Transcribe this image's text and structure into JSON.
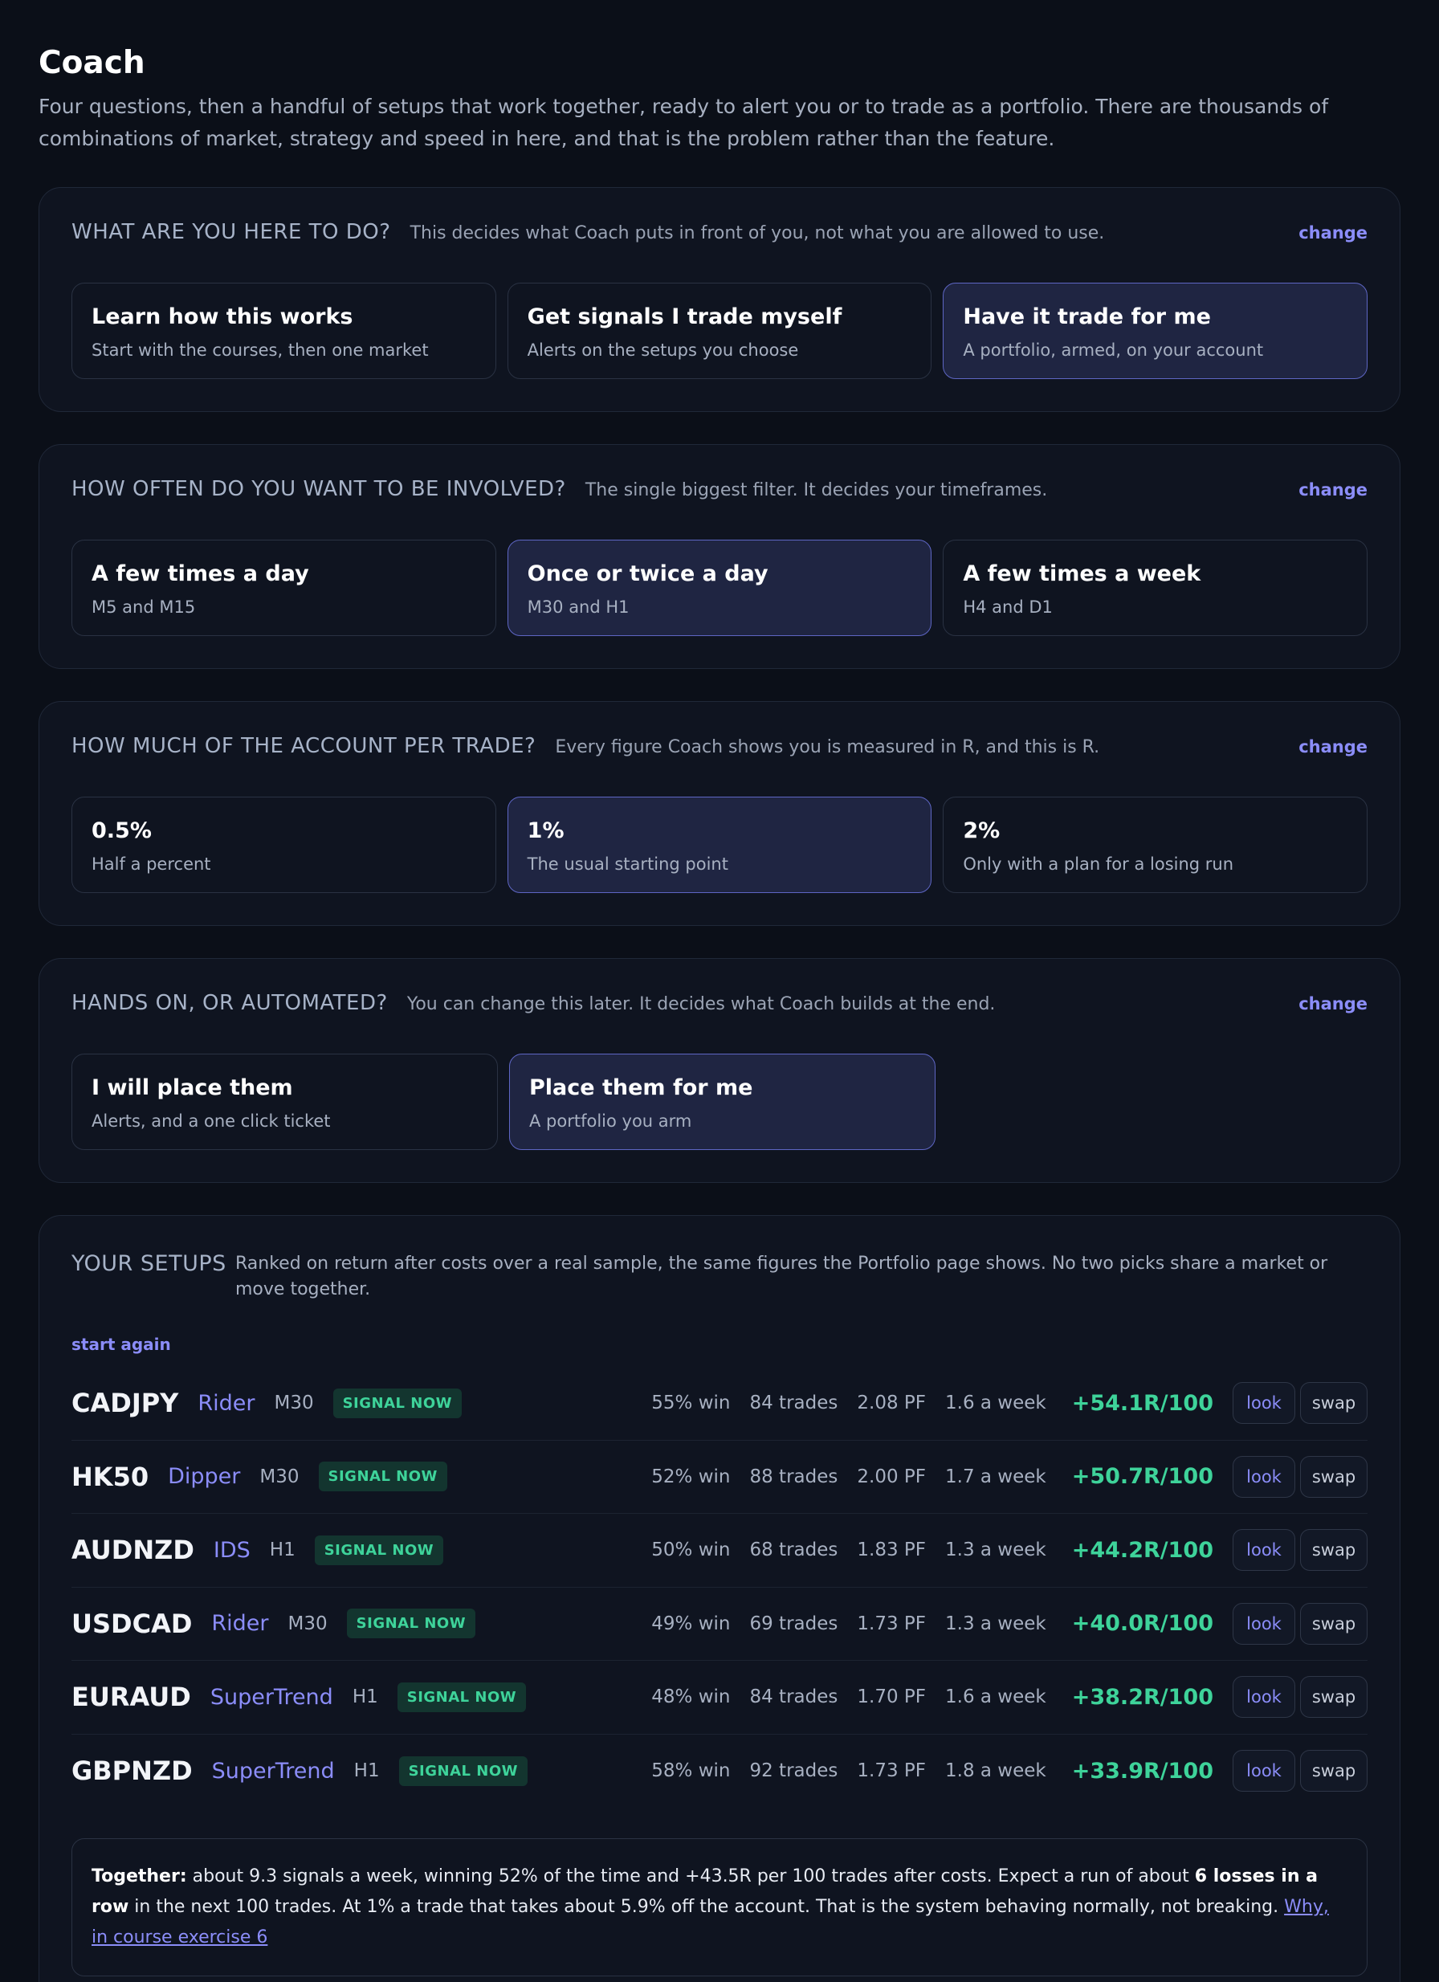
{
  "header": {
    "title": "Coach",
    "subtitle": "Four questions, then a handful of setups that work together, ready to alert you or to trade as a portfolio. There are thousands of combinations of market, strategy and speed in here, and that is the problem rather than the feature."
  },
  "questions": [
    {
      "question": "WHAT ARE YOU HERE TO DO?",
      "hint": "This decides what Coach puts in front of you, not what you are allowed to use.",
      "change_label": "change",
      "options": [
        {
          "title": "Learn how this works",
          "subtitle": "Start with the courses, then one market",
          "selected": false
        },
        {
          "title": "Get signals I trade myself",
          "subtitle": "Alerts on the setups you choose",
          "selected": false
        },
        {
          "title": "Have it trade for me",
          "subtitle": "A portfolio, armed, on your account",
          "selected": true
        }
      ]
    },
    {
      "question": "HOW OFTEN DO YOU WANT TO BE INVOLVED?",
      "hint": "The single biggest filter. It decides your timeframes.",
      "change_label": "change",
      "options": [
        {
          "title": "A few times a day",
          "subtitle": "M5 and M15",
          "selected": false
        },
        {
          "title": "Once or twice a day",
          "subtitle": "M30 and H1",
          "selected": true
        },
        {
          "title": "A few times a week",
          "subtitle": "H4 and D1",
          "selected": false
        }
      ]
    },
    {
      "question": "HOW MUCH OF THE ACCOUNT PER TRADE?",
      "hint": "Every figure Coach shows you is measured in R, and this is R.",
      "change_label": "change",
      "options": [
        {
          "title": "0.5%",
          "subtitle": "Half a percent",
          "selected": false
        },
        {
          "title": "1%",
          "subtitle": "The usual starting point",
          "selected": true
        },
        {
          "title": "2%",
          "subtitle": "Only with a plan for a losing run",
          "selected": false
        }
      ]
    },
    {
      "question": "HANDS ON, OR AUTOMATED?",
      "hint": "You can change this later. It decides what Coach builds at the end.",
      "change_label": "change",
      "options": [
        {
          "title": "I will place them",
          "subtitle": "Alerts, and a one click ticket",
          "selected": false
        },
        {
          "title": "Place them for me",
          "subtitle": "A portfolio you arm",
          "selected": true
        }
      ]
    }
  ],
  "setups": {
    "label": "YOUR SETUPS",
    "description": "Ranked on return after costs over a real sample, the same figures the Portfolio page shows. No two picks share a market or move together.",
    "start_again": "start again",
    "look_label": "look",
    "swap_label": "swap",
    "rows": [
      {
        "symbol": "CADJPY",
        "strategy": "Rider",
        "timeframe": "M30",
        "badge": "SIGNAL NOW",
        "win": "55% win",
        "trades": "84 trades",
        "pf": "2.08 PF",
        "freq": "1.6 a week",
        "ret": "+54.1R/100"
      },
      {
        "symbol": "HK50",
        "strategy": "Dipper",
        "timeframe": "M30",
        "badge": "SIGNAL NOW",
        "win": "52% win",
        "trades": "88 trades",
        "pf": "2.00 PF",
        "freq": "1.7 a week",
        "ret": "+50.7R/100"
      },
      {
        "symbol": "AUDNZD",
        "strategy": "IDS",
        "timeframe": "H1",
        "badge": "SIGNAL NOW",
        "win": "50% win",
        "trades": "68 trades",
        "pf": "1.83 PF",
        "freq": "1.3 a week",
        "ret": "+44.2R/100"
      },
      {
        "symbol": "USDCAD",
        "strategy": "Rider",
        "timeframe": "M30",
        "badge": "SIGNAL NOW",
        "win": "49% win",
        "trades": "69 trades",
        "pf": "1.73 PF",
        "freq": "1.3 a week",
        "ret": "+40.0R/100"
      },
      {
        "symbol": "EURAUD",
        "strategy": "SuperTrend",
        "timeframe": "H1",
        "badge": "SIGNAL NOW",
        "win": "48% win",
        "trades": "84 trades",
        "pf": "1.70 PF",
        "freq": "1.6 a week",
        "ret": "+38.2R/100"
      },
      {
        "symbol": "GBPNZD",
        "strategy": "SuperTrend",
        "timeframe": "H1",
        "badge": "SIGNAL NOW",
        "win": "58% win",
        "trades": "92 trades",
        "pf": "1.73 PF",
        "freq": "1.8 a week",
        "ret": "+33.9R/100"
      }
    ],
    "summary": {
      "lead": "Together:",
      "text1": " about 9.3 signals a week, winning 52% of the time and +43.5R per 100 trades after costs. Expect a run of about ",
      "emph": "6 losses in a row",
      "text2": " in the next 100 trades. At 1% a trade that takes about 5.9% off the account. That is the system behaving normally, not breaking. ",
      "link": "Why, in course exercise 6"
    }
  },
  "colors": {
    "background": "#0b0f18",
    "card": "#0f1420",
    "accent": "#8b8df9",
    "positive": "#3ed39a",
    "selected": "#1f2542"
  }
}
